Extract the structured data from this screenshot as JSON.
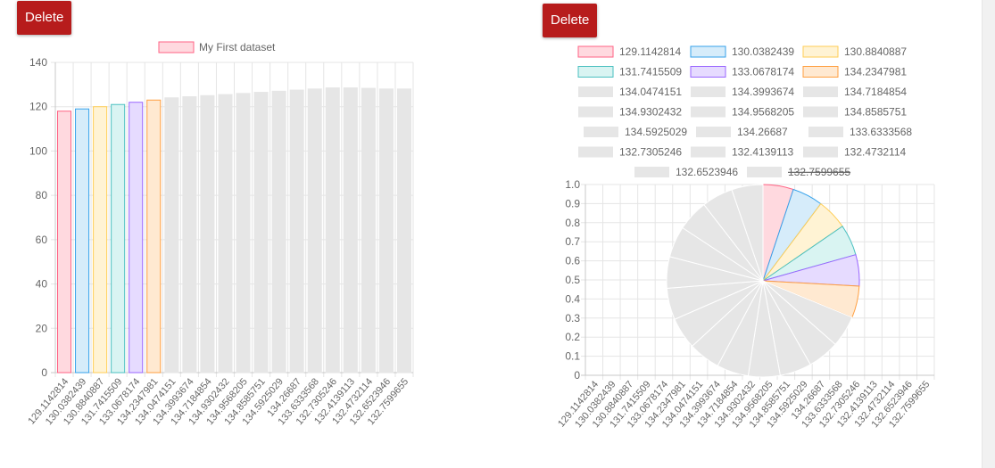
{
  "buttons": {
    "delete_left": "Delete",
    "delete_right": "Delete"
  },
  "colors": {
    "palette_bg": [
      "#ffd9df",
      "#d6ecfa",
      "#fff3d4",
      "#d9f4f2",
      "#e6dbff",
      "#ffe9d1"
    ],
    "palette_border": [
      "#ff6384",
      "#36a2eb",
      "#ffce56",
      "#4bc0c0",
      "#9966ff",
      "#ff9f40"
    ],
    "default_bg": "#e6e6e6",
    "grid": "#e5e5e5",
    "axis": "#c8c8c8",
    "text": "#666666",
    "button": "#b71c1c"
  },
  "chart_data": [
    {
      "type": "bar",
      "legend": [
        "My First dataset"
      ],
      "legend_position": "top",
      "categories": [
        "129.1142814",
        "130.0382439",
        "130.8840887",
        "131.7415509",
        "133.0678174",
        "134.2347981",
        "134.0474151",
        "134.3993674",
        "134.7184854",
        "134.9302432",
        "134.9568205",
        "134.8585751",
        "134.5925029",
        "134.26687",
        "133.6333568",
        "132.7305246",
        "132.4139113",
        "132.4732114",
        "132.6523946",
        "132.7599655"
      ],
      "series": [
        {
          "name": "My First dataset",
          "values": [
            118,
            119,
            120,
            121,
            122,
            123,
            124,
            124.5,
            125,
            125.5,
            126,
            126.5,
            127,
            127.5,
            128,
            128.5,
            128.5,
            128.3,
            128,
            128
          ]
        }
      ],
      "ylim": [
        0,
        140
      ],
      "yticks": [
        "0",
        "20",
        "40",
        "60",
        "80",
        "100",
        "120",
        "140"
      ],
      "grid": true
    },
    {
      "type": "pie",
      "legend_position": "top",
      "labels": [
        "129.1142814",
        "130.0382439",
        "130.8840887",
        "131.7415509",
        "133.0678174",
        "134.2347981",
        "134.0474151",
        "134.3993674",
        "134.7184854",
        "134.9302432",
        "134.9568205",
        "134.8585751",
        "134.5925029",
        "134.26687",
        "133.6333568",
        "132.7305246",
        "132.4139113",
        "132.4732114",
        "132.6523946",
        "132.7599655"
      ],
      "values": [
        129.1142814,
        130.0382439,
        130.8840887,
        131.7415509,
        133.0678174,
        134.2347981,
        134.0474151,
        134.3993674,
        134.7184854,
        134.9302432,
        134.9568205,
        134.8585751,
        134.5925029,
        134.26687,
        133.6333568,
        132.7305246,
        132.4139113,
        132.4732114,
        132.6523946,
        132.7599655
      ],
      "hidden_labels": [
        "132.7599655"
      ],
      "ylim": [
        0,
        1.0
      ],
      "yticks": [
        "0",
        "0.1",
        "0.2",
        "0.3",
        "0.4",
        "0.5",
        "0.6",
        "0.7",
        "0.8",
        "0.9",
        "1.0"
      ],
      "grid": true
    }
  ]
}
